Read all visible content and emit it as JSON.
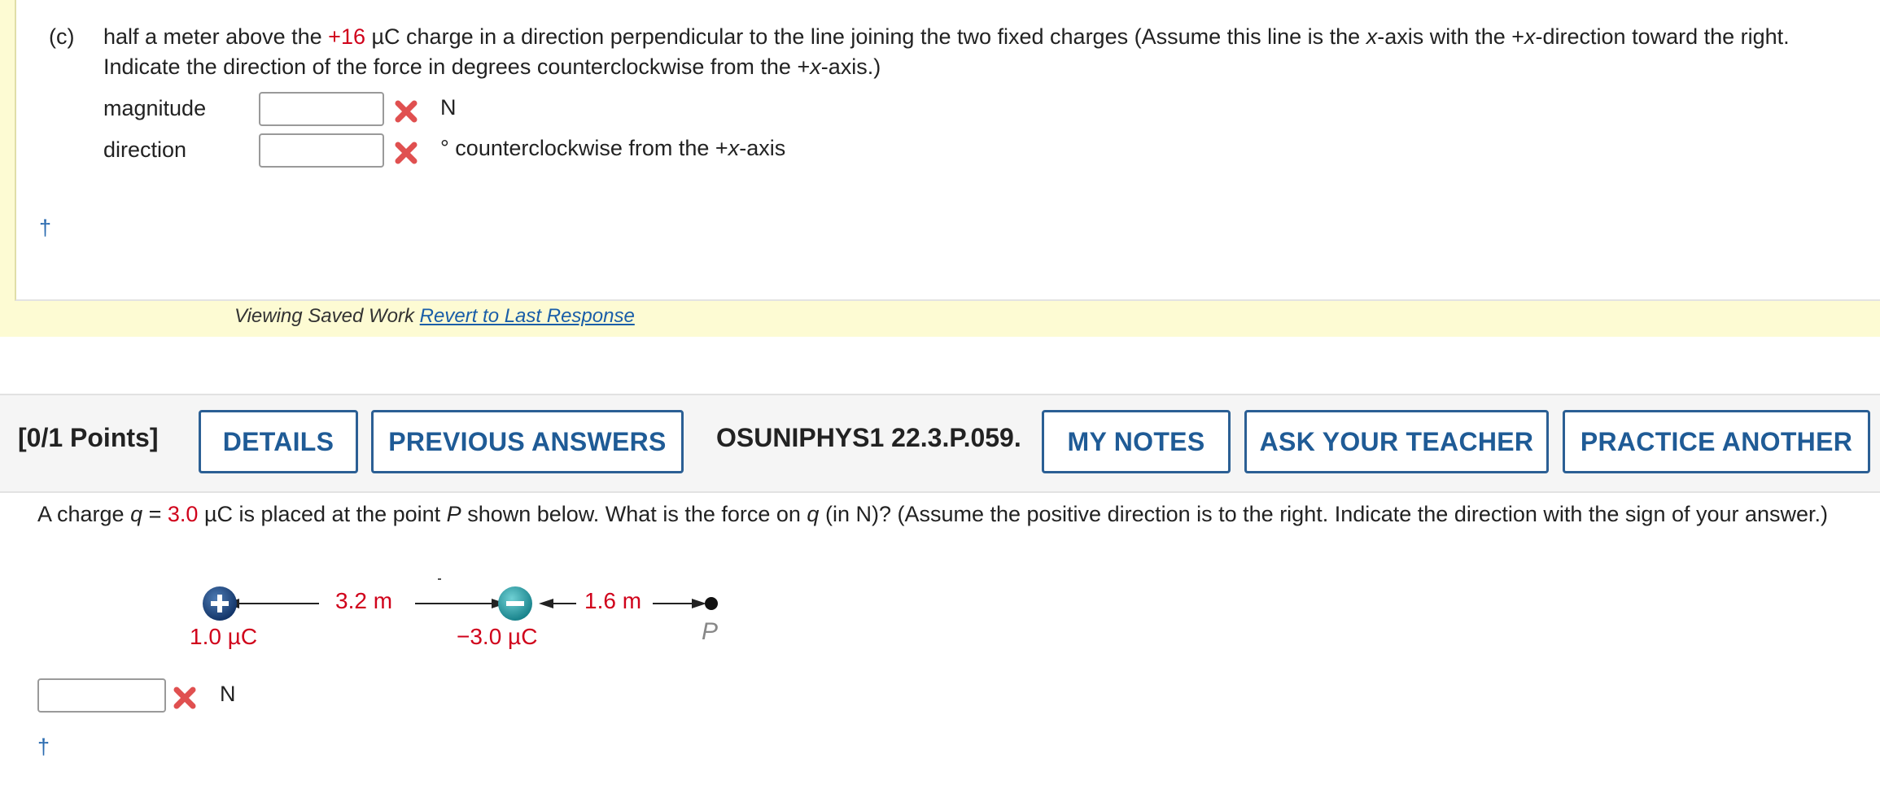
{
  "part_c": {
    "label": "(c)",
    "text_before": "half a meter above the ",
    "charge_value": "+16",
    "text_after": " µC charge in a direction perpendicular to the line joining the two fixed charges (Assume this line is the ",
    "x1": "x",
    "text_mid1": "-axis with the +",
    "x2": "x",
    "text_mid2": "-direction toward the right. Indicate the direction of the force in degrees counterclockwise from the +",
    "x3": "x",
    "text_end": "-axis.)",
    "magnitude_label": "magnitude",
    "magnitude_value": "",
    "magnitude_unit": "N",
    "direction_label": "direction",
    "direction_value": "",
    "direction_unit_prefix": "° counterclockwise from the +",
    "direction_unit_x": "x",
    "direction_unit_suffix": "-axis",
    "dagger": "†"
  },
  "saved_work": {
    "text": "Viewing Saved Work ",
    "link": "Revert to Last Response"
  },
  "toolbar": {
    "points": "[0/1 Points]",
    "details": "DETAILS",
    "previous_answers": "PREVIOUS ANSWERS",
    "problem_id": "OSUNIPHYS1 22.3.P.059.",
    "my_notes": "MY NOTES",
    "ask_teacher": "ASK YOUR TEACHER",
    "practice_another": "PRACTICE ANOTHER"
  },
  "problem": {
    "text_1": "A charge ",
    "q": "q",
    "eq": " = ",
    "q_value": "3.0",
    "text_2": " µC is placed at the point ",
    "P": "P",
    "text_3": " shown below. What is the force on ",
    "q2": "q",
    "text_4": " (in N)? (Assume the positive direction is to the right. Indicate the direction with the sign of your answer.)",
    "answer_value": "",
    "answer_unit": "N",
    "dagger": "†"
  },
  "diagram": {
    "dist_1": "3.2 m",
    "dist_2": "1.6 m",
    "charge_1": "1.0 µC",
    "charge_2": "−3.0 µC",
    "point_label": "P"
  },
  "colors": {
    "accent_blue": "#1f5b96",
    "error_red": "#e05050",
    "value_red": "#d0021b",
    "panel_yellow": "#fdfbd3"
  }
}
